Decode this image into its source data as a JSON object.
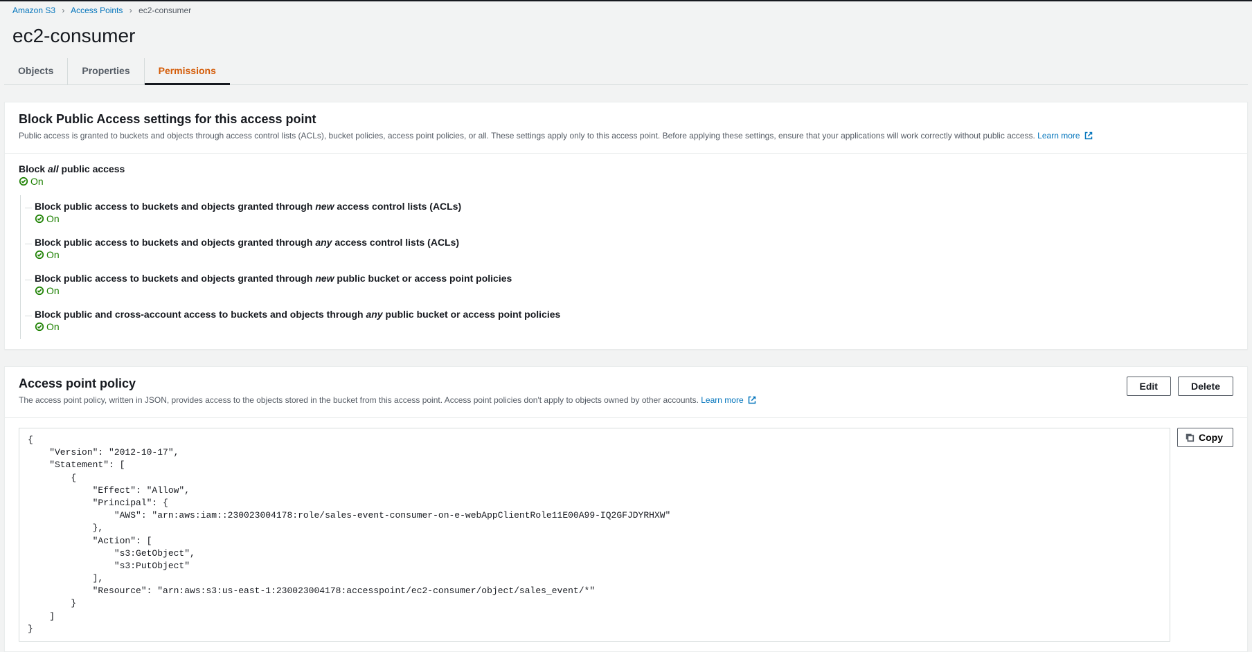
{
  "breadcrumbs": {
    "items": [
      {
        "label": "Amazon S3",
        "link": true
      },
      {
        "label": "Access Points",
        "link": true
      },
      {
        "label": "ec2-consumer",
        "link": false
      }
    ]
  },
  "page_title": "ec2-consumer",
  "tabs": {
    "objects": "Objects",
    "properties": "Properties",
    "permissions": "Permissions"
  },
  "block_public_access": {
    "heading": "Block Public Access settings for this access point",
    "description": "Public access is granted to buckets and objects through access control lists (ACLs), bucket policies, access point policies, or all. These settings apply only to this access point. Before applying these settings, ensure that your applications will work correctly without public access. ",
    "learn_more": "Learn more",
    "root_label_prefix": "Block ",
    "root_label_em": "all",
    "root_label_suffix": " public access",
    "root_status": "On",
    "items": [
      {
        "prefix": "Block public access to buckets and objects granted through ",
        "em": "new",
        "suffix": " access control lists (ACLs)",
        "status": "On"
      },
      {
        "prefix": "Block public access to buckets and objects granted through ",
        "em": "any",
        "suffix": " access control lists (ACLs)",
        "status": "On"
      },
      {
        "prefix": "Block public access to buckets and objects granted through ",
        "em": "new",
        "suffix": " public bucket or access point policies",
        "status": "On"
      },
      {
        "prefix": "Block public and cross-account access to buckets and objects through ",
        "em": "any",
        "suffix": " public bucket or access point policies",
        "status": "On"
      }
    ]
  },
  "policy": {
    "heading": "Access point policy",
    "description": "The access point policy, written in JSON, provides access to the objects stored in the bucket from this access point. Access point policies don't apply to objects owned by other accounts. ",
    "learn_more": "Learn more",
    "edit_label": "Edit",
    "delete_label": "Delete",
    "copy_label": "Copy",
    "code": "{\n    \"Version\": \"2012-10-17\",\n    \"Statement\": [\n        {\n            \"Effect\": \"Allow\",\n            \"Principal\": {\n                \"AWS\": \"arn:aws:iam::230023004178:role/sales-event-consumer-on-e-webAppClientRole11E00A99-IQ2GFJDYRHXW\"\n            },\n            \"Action\": [\n                \"s3:GetObject\",\n                \"s3:PutObject\"\n            ],\n            \"Resource\": \"arn:aws:s3:us-east-1:230023004178:accesspoint/ec2-consumer/object/sales_event/*\"\n        }\n    ]\n}"
  }
}
